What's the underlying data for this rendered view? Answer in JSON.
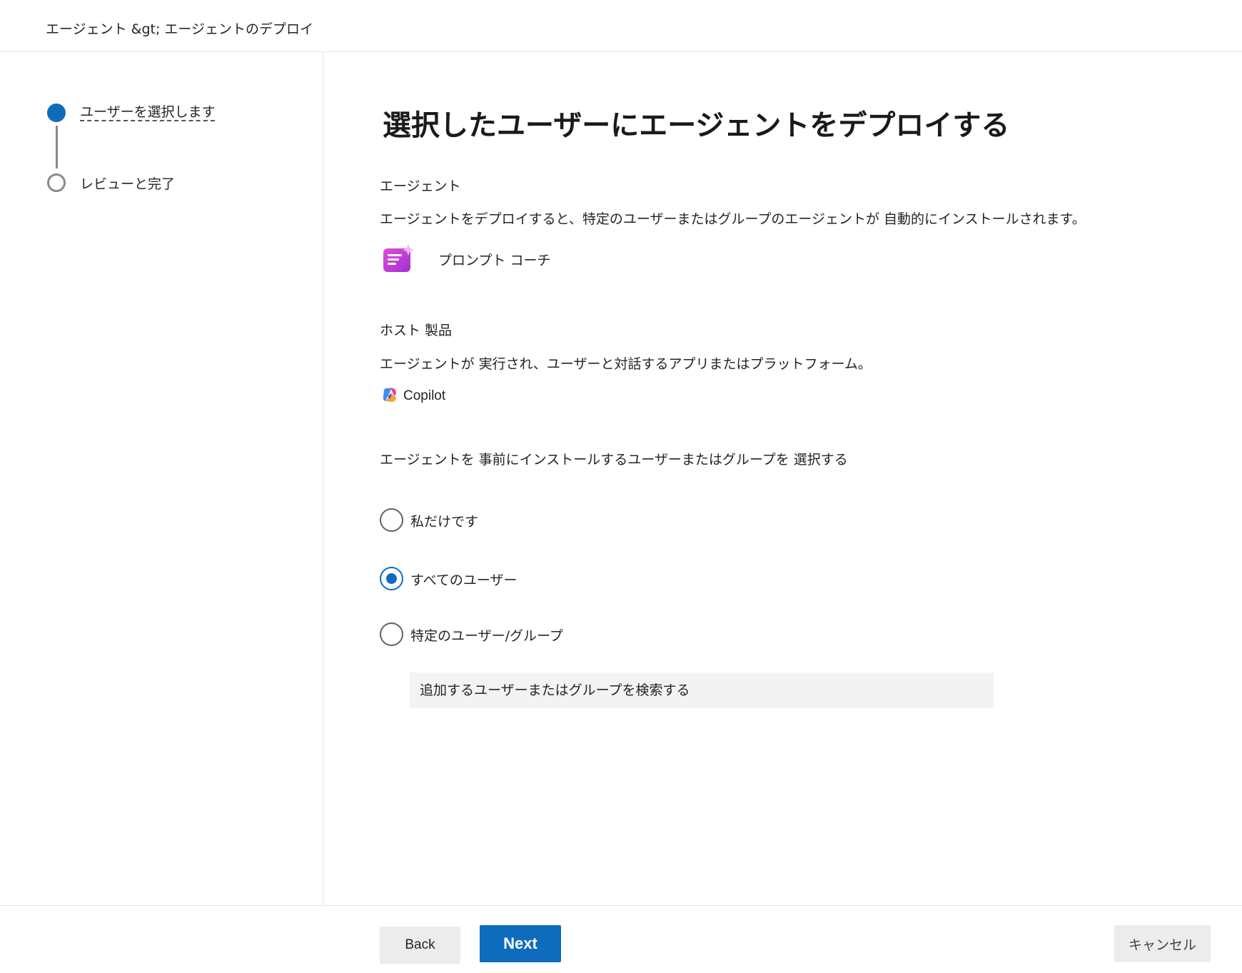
{
  "breadcrumb": "エージェント  &gt; エージェントのデプロイ",
  "steps": [
    {
      "label": "ユーザーを選択します",
      "state": "active"
    },
    {
      "label": "レビューと完了",
      "state": "pending"
    }
  ],
  "page_title": "選択したユーザーにエージェントをデプロイする",
  "agent_section": {
    "heading": "エージェント",
    "description": "エージェントをデプロイすると、特定のユーザーまたはグループのエージェントが 自動的にインストールされます。",
    "agent_name": "プロンプト コーチ",
    "agent_icon": "prompt-coach-icon"
  },
  "host_section": {
    "heading": "ホスト 製品",
    "description": "エージェントが 実行され、ユーザーと対話するアプリまたはプラットフォーム。",
    "product_name": "Copilot",
    "product_icon": "copilot-icon"
  },
  "preinstall_section": {
    "heading": "エージェントを 事前にインストールするユーザーまたはグループを 選択する",
    "options": [
      {
        "label": "私だけです",
        "checked": false
      },
      {
        "label": "すべてのユーザー",
        "checked": true
      },
      {
        "label": "特定のユーザー/グループ",
        "checked": false
      }
    ],
    "search_placeholder": "追加するユーザーまたはグループを検索する"
  },
  "footer": {
    "back_label": "Back",
    "next_label": "Next",
    "cancel_label": "キャンセル"
  },
  "colors": {
    "accent": "#0f6cbd",
    "step_inactive": "#8a8a8a",
    "button_secondary": "#ececec",
    "search_background": "#f3f3f3"
  }
}
